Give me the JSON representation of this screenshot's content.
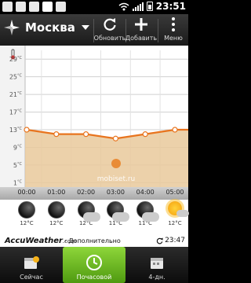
{
  "status_bar": {
    "time": "23:51"
  },
  "toolbar": {
    "location": "Москва",
    "refresh_label": "Обновить",
    "add_label": "Добавить",
    "menu_label": "Меню"
  },
  "chart_data": {
    "type": "area",
    "y_unit_icon": "thermometer-icon",
    "y_ticks": [
      "29°C",
      "25°C",
      "21°C",
      "17°C",
      "13°C",
      "9°C",
      "5°C",
      "1°C"
    ],
    "ylim": [
      0,
      31
    ],
    "x": [
      "00:00",
      "01:00",
      "02:00",
      "03:00",
      "04:00",
      "05:00"
    ],
    "values": [
      13,
      12,
      12,
      11,
      12,
      13
    ],
    "line_color": "#e8741e",
    "fill_color": "#e9c99b",
    "watermark": "mobiset.ru"
  },
  "forecast": [
    {
      "icon": "moon-icon",
      "temp": "12°C"
    },
    {
      "icon": "moon-icon",
      "temp": "12°C"
    },
    {
      "icon": "moon-cloud-icon",
      "temp": "12°C"
    },
    {
      "icon": "moon-cloud-icon",
      "temp": "11°C"
    },
    {
      "icon": "moon-cloud-icon",
      "temp": "11°C"
    },
    {
      "icon": "sun-cloud-icon",
      "temp": "12°C"
    }
  ],
  "brand": {
    "name": "AccuWeather",
    "suffix": ".com",
    "more": "- Дополнительно",
    "updated": "23:47"
  },
  "bottom_nav": {
    "now": "Сейчас",
    "hourly": "Почасовой",
    "four_day": "4-дн."
  }
}
